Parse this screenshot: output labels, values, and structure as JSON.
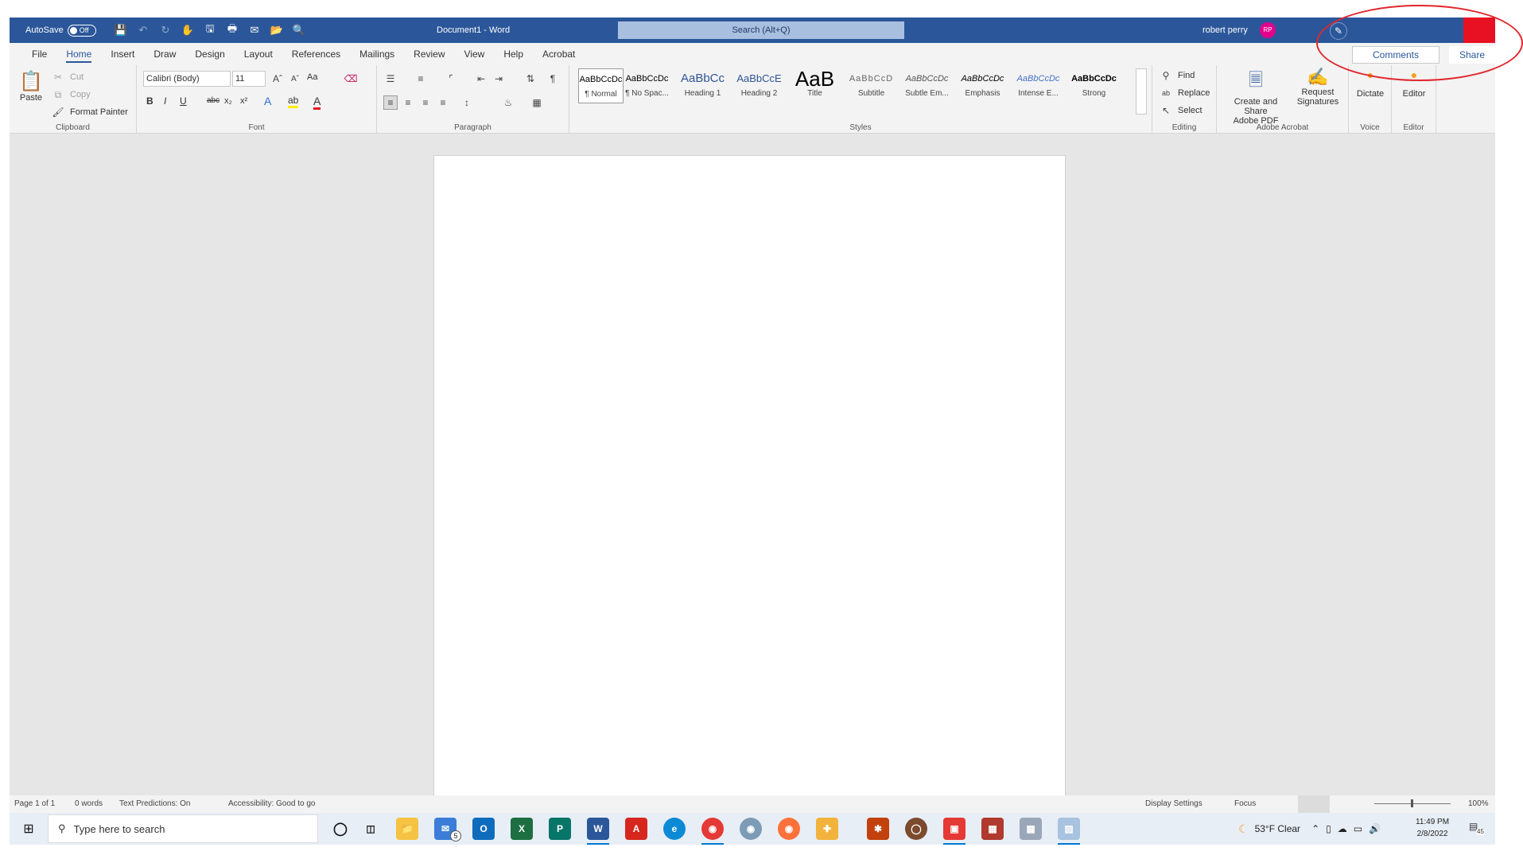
{
  "titlebar": {
    "autosave_label": "AutoSave",
    "autosave_state": "Off",
    "doc_title": "Document1  -  Word",
    "search_placeholder": "Search (Alt+Q)",
    "user_name": "robert perry",
    "user_initials": "RP"
  },
  "tabs": [
    "File",
    "Home",
    "Insert",
    "Draw",
    "Design",
    "Layout",
    "References",
    "Mailings",
    "Review",
    "View",
    "Help",
    "Acrobat"
  ],
  "active_tab": "Home",
  "actions": {
    "comments": "Comments",
    "share": "Share"
  },
  "clipboard": {
    "paste": "Paste",
    "cut": "Cut",
    "copy": "Copy",
    "format_painter": "Format Painter",
    "label": "Clipboard"
  },
  "font": {
    "name": "Calibri (Body)",
    "size": "11",
    "label": "Font",
    "change_case": "Aa"
  },
  "paragraph": {
    "label": "Paragraph"
  },
  "styles": {
    "label": "Styles",
    "items": [
      {
        "preview": "AaBbCcDc",
        "name": "¶ Normal"
      },
      {
        "preview": "AaBbCcDc",
        "name": "¶ No Spac..."
      },
      {
        "preview": "AaBbCc",
        "name": "Heading 1"
      },
      {
        "preview": "AaBbCcE",
        "name": "Heading 2"
      },
      {
        "preview": "AaB",
        "name": "Title"
      },
      {
        "preview": "AaBbCcD",
        "name": "Subtitle"
      },
      {
        "preview": "AaBbCcDc",
        "name": "Subtle Em..."
      },
      {
        "preview": "AaBbCcDc",
        "name": "Emphasis"
      },
      {
        "preview": "AaBbCcDc",
        "name": "Intense E..."
      },
      {
        "preview": "AaBbCcDc",
        "name": "Strong"
      }
    ]
  },
  "editing": {
    "find": "Find",
    "replace": "Replace",
    "select": "Select",
    "label": "Editing"
  },
  "acrobat": {
    "create_share": "Create and Share",
    "create_share2": "Adobe PDF",
    "request": "Request",
    "request2": "Signatures",
    "label": "Adobe Acrobat"
  },
  "voice": {
    "dictate": "Dictate",
    "label": "Voice"
  },
  "editor": {
    "editor": "Editor",
    "label": "Editor"
  },
  "statusbar": {
    "page": "Page 1 of 1",
    "words": "0 words",
    "predictions": "Text Predictions: On",
    "accessibility": "Accessibility: Good to go",
    "display_settings": "Display Settings",
    "focus": "Focus",
    "zoom": "100%"
  },
  "taskbar": {
    "search_placeholder": "Type here to search",
    "mail_badge": "5",
    "weather": "53°F  Clear",
    "time": "11:49 PM",
    "date": "2/8/2022",
    "notif_count": "45"
  },
  "colors": {
    "word_blue": "#2b579a",
    "accent_red": "#e81123",
    "avatar_pink": "#e3008c"
  }
}
